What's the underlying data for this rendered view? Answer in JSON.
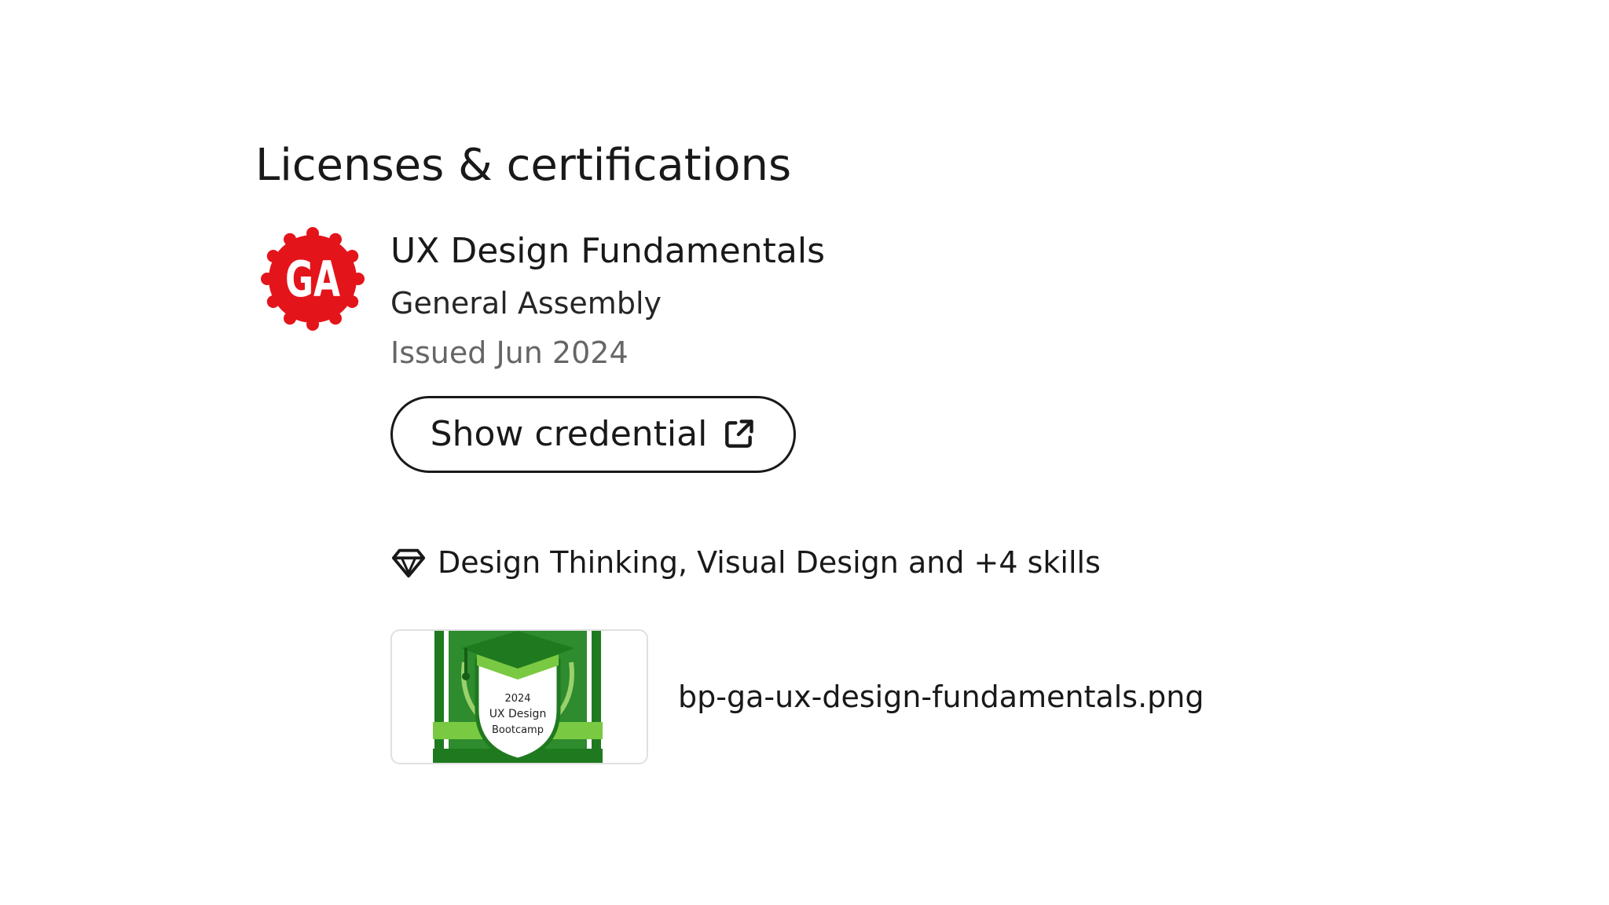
{
  "section": {
    "title": "Licenses & certifications"
  },
  "certification": {
    "name": "UX Design Fundamentals",
    "issuer": "General Assembly",
    "issued": "Issued Jun 2024",
    "issuer_logo": {
      "icon": "general-assembly-logo",
      "text": "GA",
      "color": "#e4141b"
    },
    "credential_button": {
      "label": "Show credential",
      "icon": "external-link-icon"
    },
    "skills": {
      "icon": "diamond-icon",
      "text": "Design Thinking, Visual Design and +4 skills"
    },
    "media": {
      "filename": "bp-ga-ux-design-fundamentals.png",
      "thumbnail": {
        "year": "2024",
        "line1": "UX Design",
        "line2": "Bootcamp",
        "primary_color": "#1f7a1f",
        "accent_color": "#7ac943"
      }
    }
  }
}
